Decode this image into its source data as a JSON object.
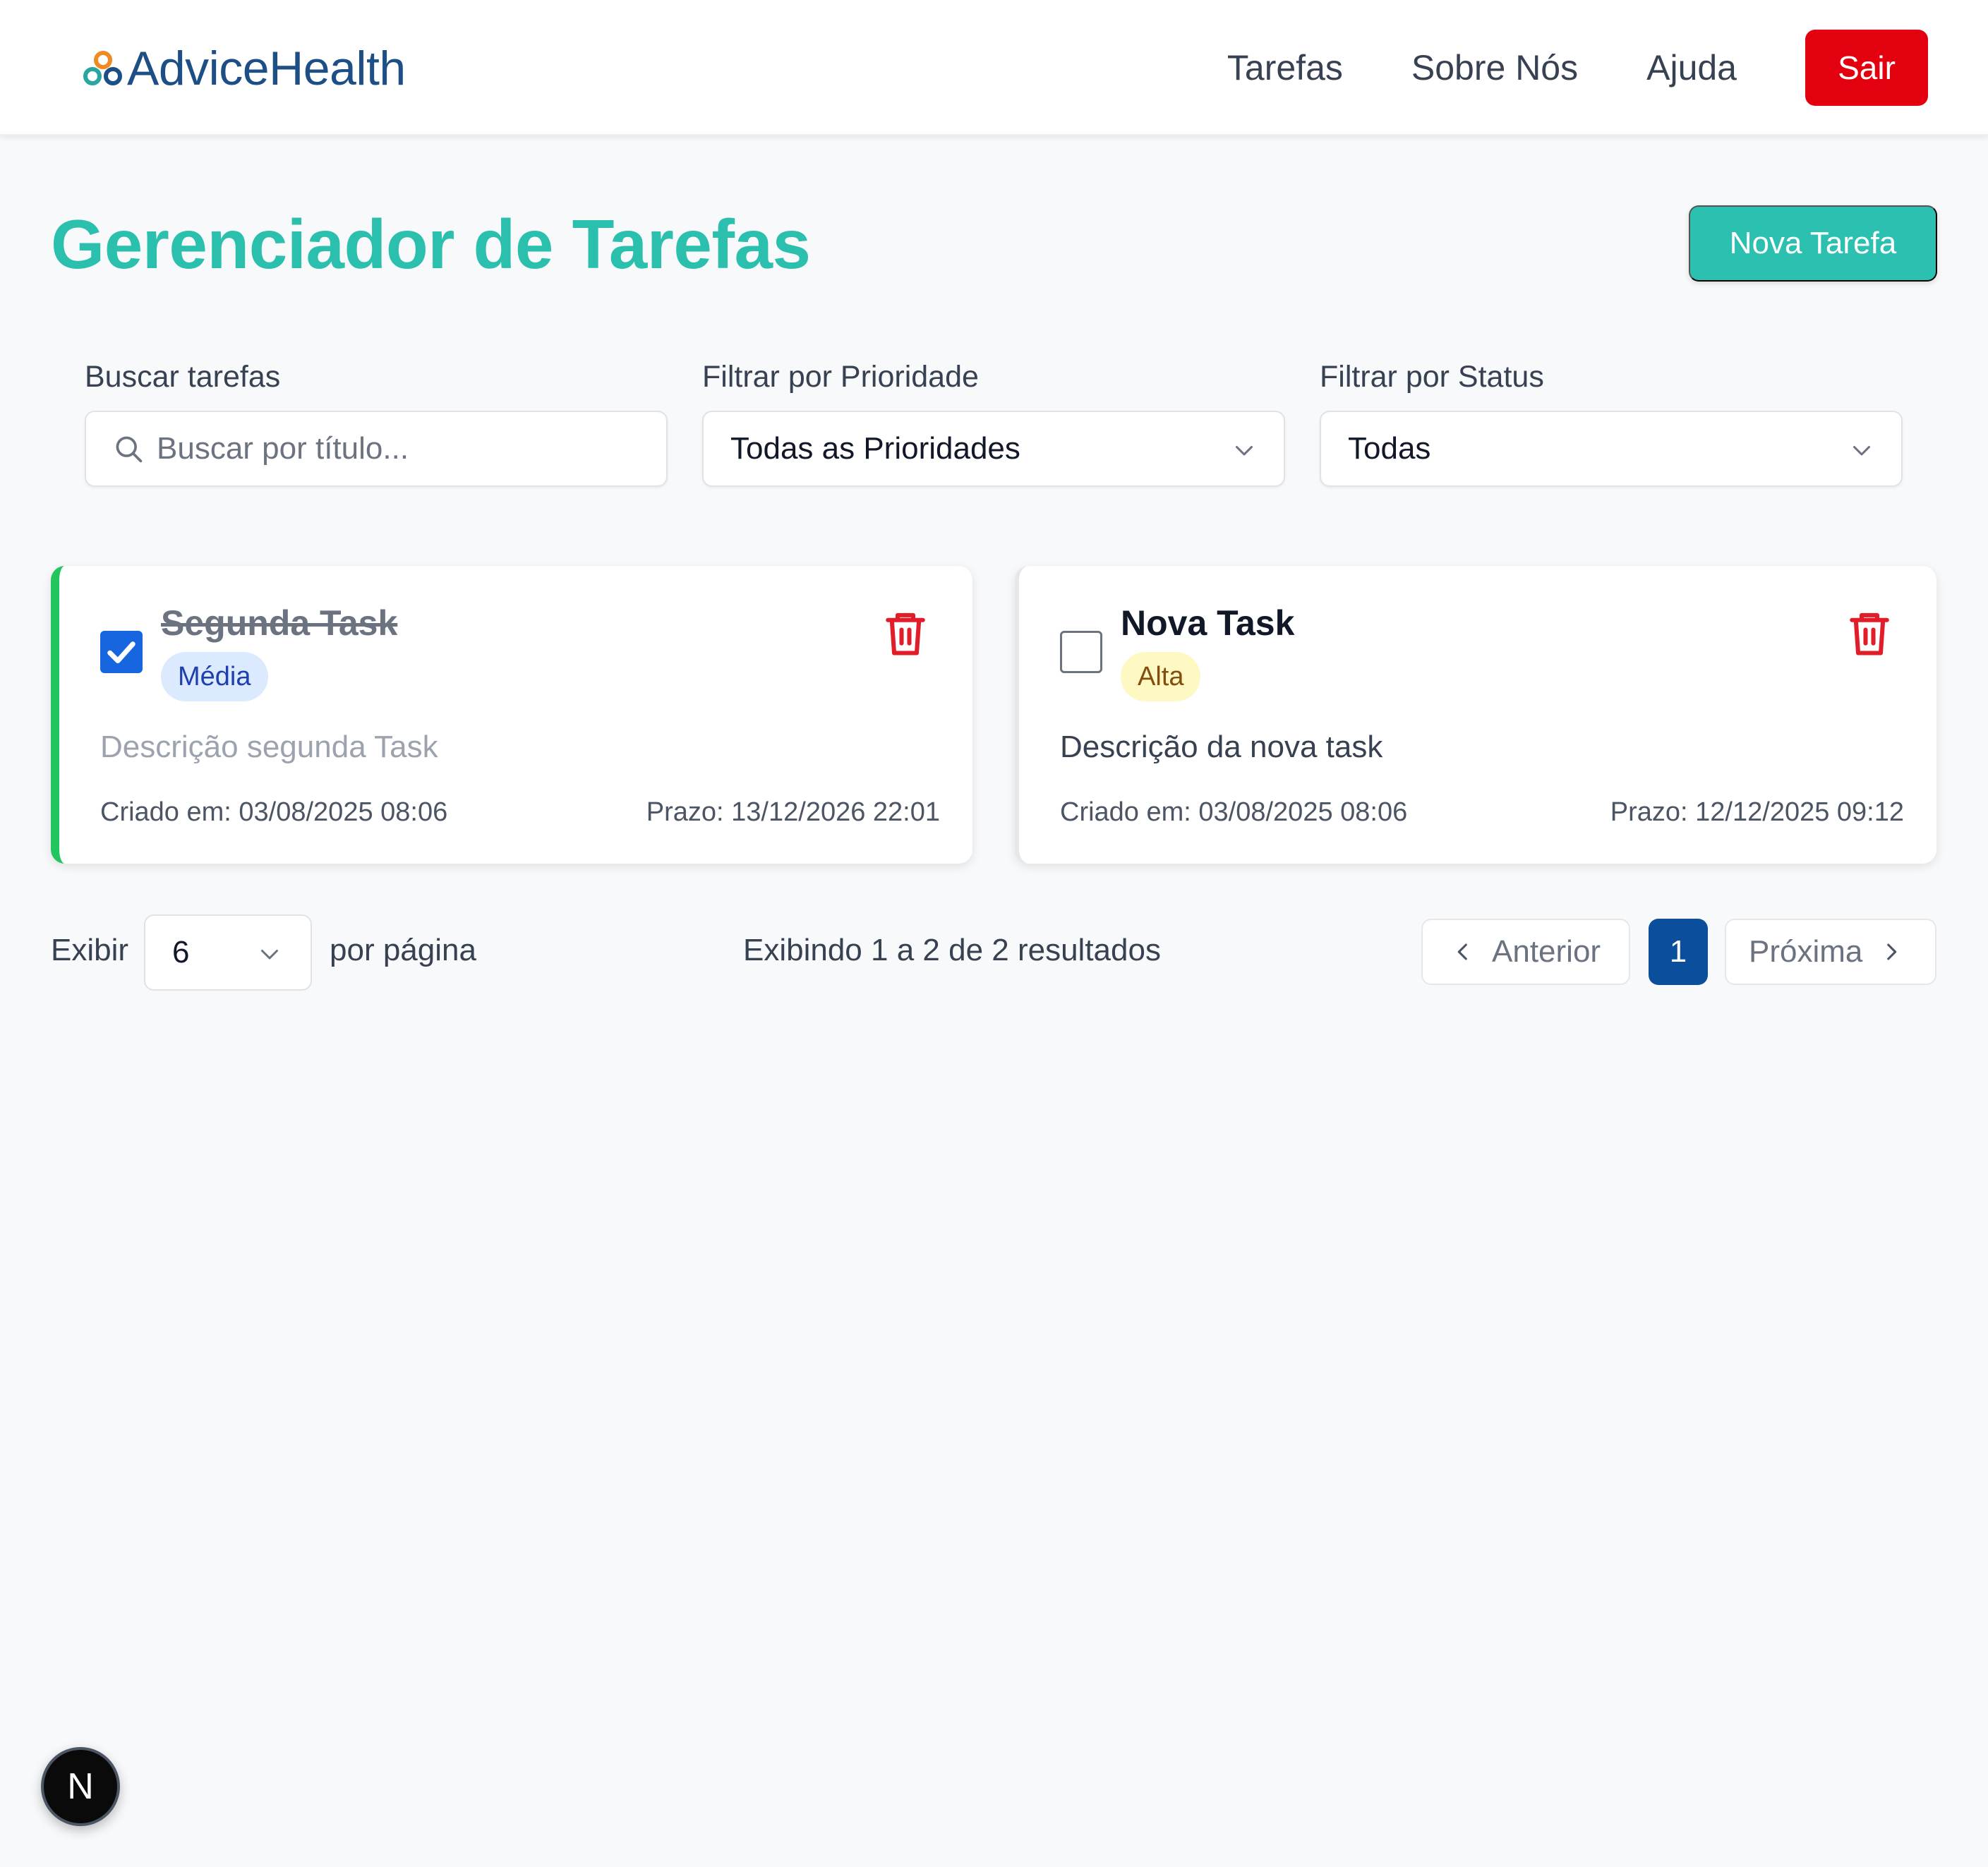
{
  "header": {
    "logo_text": "AdviceHealth",
    "nav": [
      "Tarefas",
      "Sobre Nós",
      "Ajuda"
    ],
    "logout_label": "Sair",
    "logout_color": "#e3000f"
  },
  "page": {
    "title": "Gerenciador de Tarefas",
    "new_task_label": "Nova Tarefa",
    "accent_color": "#2bbfae"
  },
  "filters": {
    "search_label": "Buscar tarefas",
    "search_placeholder": "Buscar por título...",
    "search_value": "",
    "priority_label": "Filtrar por Prioridade",
    "priority_value": "Todas as Prioridades",
    "status_label": "Filtrar por Status",
    "status_value": "Todas"
  },
  "tasks": [
    {
      "title": "Segunda Task",
      "completed": true,
      "priority": "Média",
      "description": "Descrição segunda Task",
      "created": "Criado em: 03/08/2025 08:06",
      "deadline": "Prazo: 13/12/2026 22:01"
    },
    {
      "title": "Nova Task",
      "completed": false,
      "priority": "Alta",
      "description": "Descrição da nova task",
      "created": "Criado em: 03/08/2025 08:06",
      "deadline": "Prazo: 12/12/2025 09:12"
    }
  ],
  "pagination": {
    "show_label": "Exibir",
    "per_page_value": "6",
    "per_page_label": "por página",
    "results_text": "Exibindo 1 a 2 de 2 resultados",
    "prev_label": "Anterior",
    "current_page": "1",
    "next_label": "Próxima"
  },
  "dev_badge": "N"
}
